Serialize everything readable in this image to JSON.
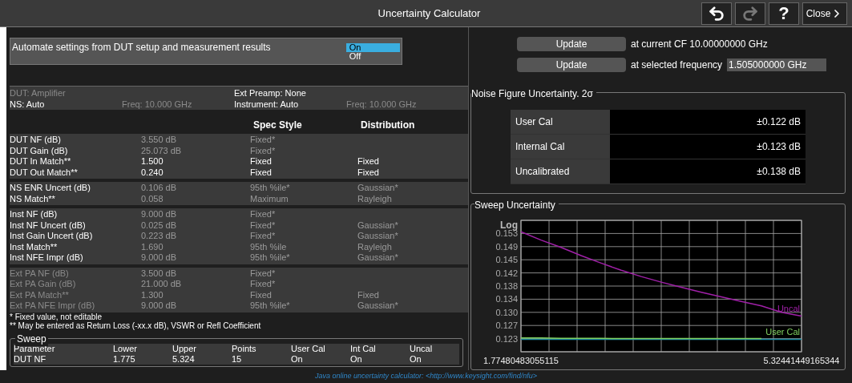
{
  "window": {
    "title": "Uncertainty Calculator",
    "help": "?",
    "close": "Close",
    "undo_disabled": false,
    "redo_disabled": true
  },
  "automate": {
    "label": "Automate settings from DUT setup and measurement results",
    "options": [
      {
        "label": "On",
        "selected": true
      },
      {
        "label": "Off",
        "selected": false
      }
    ]
  },
  "updates": [
    {
      "button": "Update",
      "text": "at current CF 10.00000000 GHz"
    },
    {
      "button": "Update",
      "text": "at selected frequency",
      "value": "1.505000000 GHz"
    }
  ],
  "setup_columns": [
    [
      {
        "text": "DUT: Amplifier",
        "disabled": true
      },
      {
        "text": "NS: Auto",
        "disabled": false
      }
    ],
    [
      {
        "text": "Freq: 10.000 GHz",
        "disabled": true
      }
    ],
    [
      {
        "text": "Ext Preamp: None",
        "disabled": false
      },
      {
        "text": "Instrument: Auto",
        "disabled": false
      }
    ],
    [
      {
        "text": "Freq: 10.000 GHz",
        "disabled": true
      }
    ]
  ],
  "params": {
    "columns": [
      "Spec Style",
      "Distribution"
    ],
    "groups": [
      [
        {
          "name": "DUT NF (dB)",
          "value": "3.550 dB",
          "spec": "Fixed*",
          "disabled": false,
          "editable": false
        },
        {
          "name": "DUT Gain (dB)",
          "value": "25.073 dB",
          "spec": "Fixed*",
          "disabled": false,
          "editable": false
        },
        {
          "name": "DUT In Match**",
          "value": "1.500",
          "spec": "Fixed",
          "distribution": "Fixed",
          "disabled": false,
          "editable": true
        },
        {
          "name": "DUT Out Match**",
          "value": "0.240",
          "spec": "Fixed",
          "distribution": "Fixed",
          "disabled": false,
          "editable": true
        }
      ],
      [
        {
          "name": "NS ENR Uncert (dB)",
          "value": "0.106 dB",
          "spec": "95th %ile*",
          "distribution": "Gaussian*",
          "disabled": false,
          "editable": false
        },
        {
          "name": "NS Match**",
          "value": "0.058",
          "spec": "Maximum",
          "distribution": "Rayleigh",
          "disabled": false,
          "editable": false
        }
      ],
      [
        {
          "name": "Inst NF (dB)",
          "value": "9.000 dB",
          "spec": "Fixed*",
          "disabled": false,
          "editable": false
        },
        {
          "name": "Inst NF Uncert (dB)",
          "value": "0.025 dB",
          "spec": "Fixed*",
          "distribution": "Gaussian*",
          "disabled": false,
          "editable": false
        },
        {
          "name": "Inst Gain Uncert (dB)",
          "value": "0.223 dB",
          "spec": "Fixed*",
          "distribution": "Gaussian*",
          "disabled": false,
          "editable": false
        },
        {
          "name": "Inst Match**",
          "value": "1.690",
          "spec": "95th %ile",
          "distribution": "Rayleigh",
          "disabled": false,
          "editable": false
        },
        {
          "name": "Inst NFE Impr (dB)",
          "value": "9.000 dB",
          "spec": "95th %ile*",
          "distribution": "Gaussian*",
          "disabled": false,
          "editable": false
        }
      ],
      [
        {
          "name": "Ext PA NF (dB)",
          "value": "3.500 dB",
          "spec": "Fixed*",
          "disabled": true,
          "editable": false
        },
        {
          "name": "Ext PA Gain (dB)",
          "value": "21.000 dB",
          "spec": "Fixed*",
          "disabled": true,
          "editable": false
        },
        {
          "name": "Ext PA Match**",
          "value": "1.300",
          "spec": "Fixed",
          "distribution": "Fixed",
          "disabled": true,
          "editable": false
        },
        {
          "name": "Ext PA NFE Impr (dB)",
          "value": "9.000 dB",
          "spec": "95th %ile*",
          "distribution": "Gaussian*",
          "disabled": true,
          "editable": false
        }
      ]
    ]
  },
  "footnotes": [
    "* Fixed value, not editable",
    "** May be entered as Return Loss (-xx.x dB), VSWR or Refl Coefficient"
  ],
  "sweep": {
    "title": "Sweep",
    "columns": [
      "Parameter",
      "Lower",
      "Upper",
      "Points",
      "User Cal",
      "Int Cal",
      "Uncal"
    ],
    "rows": [
      [
        "DUT NF",
        "1.775",
        "5.324",
        "15",
        "On",
        "On",
        "On"
      ]
    ]
  },
  "nf_uncertainty": {
    "title": "Noise Figure Uncertainty. 2σ",
    "rows": [
      {
        "label": "User Cal",
        "value": "±0.122 dB"
      },
      {
        "label": "Internal Cal",
        "value": "±0.123 dB"
      },
      {
        "label": "Uncalibrated",
        "value": "±0.138 dB"
      }
    ]
  },
  "sweep_uncertainty": {
    "title": "Sweep Uncertainty",
    "chart_data": {
      "type": "line",
      "ylabel": "Log",
      "grid": true,
      "x": [
        1.77480483055115,
        2.0283,
        2.2819,
        2.5354,
        2.789,
        3.0425,
        3.2961,
        3.5496,
        3.8032,
        4.0567,
        4.3103,
        4.5638,
        4.8173,
        5.0709,
        5.32441449165344
      ],
      "series": [
        {
          "name": "Uncal",
          "color": "#a020a8",
          "values": [
            0.1535,
            0.151,
            0.1488,
            0.1466,
            0.1446,
            0.1427,
            0.1409,
            0.1392,
            0.1376,
            0.1361,
            0.1347,
            0.1334,
            0.1322,
            0.1305,
            0.1295
          ]
        },
        {
          "color": "#1a8aa0",
          "values": [
            0.1228,
            0.1228,
            0.1228,
            0.1228,
            0.1228,
            0.1228,
            0.1228,
            0.1228,
            0.1228,
            0.1228,
            0.1228,
            0.1228,
            0.1228,
            0.1228,
            0.1228
          ]
        },
        {
          "name": "User Cal",
          "color": "#80d060",
          "values": [
            0.1232,
            0.1232,
            0.1231,
            0.1231,
            0.1231,
            0.123,
            0.123,
            0.123,
            0.123,
            0.123,
            0.123,
            0.123,
            0.123,
            null,
            null
          ]
        }
      ],
      "xlim": [
        1.77480483055115,
        5.32441449165344
      ],
      "ylim": [
        0.119,
        0.157
      ],
      "xticks": [
        {
          "value": 1.77480483055115,
          "label": "1.77480483055115"
        },
        {
          "value": 5.32441449165344,
          "label": "5.32441449165344"
        }
      ],
      "yticks": [
        0.153,
        0.149,
        {
          "value": 0.1455,
          "label": "0.145"
        },
        0.142,
        0.138,
        0.134,
        {
          "value": 0.1305,
          "label": "0.130"
        },
        0.127,
        0.123
      ]
    }
  },
  "footer_link": "Java online uncertainty calculator: <http://www.keysight.com/find/nfu>"
}
